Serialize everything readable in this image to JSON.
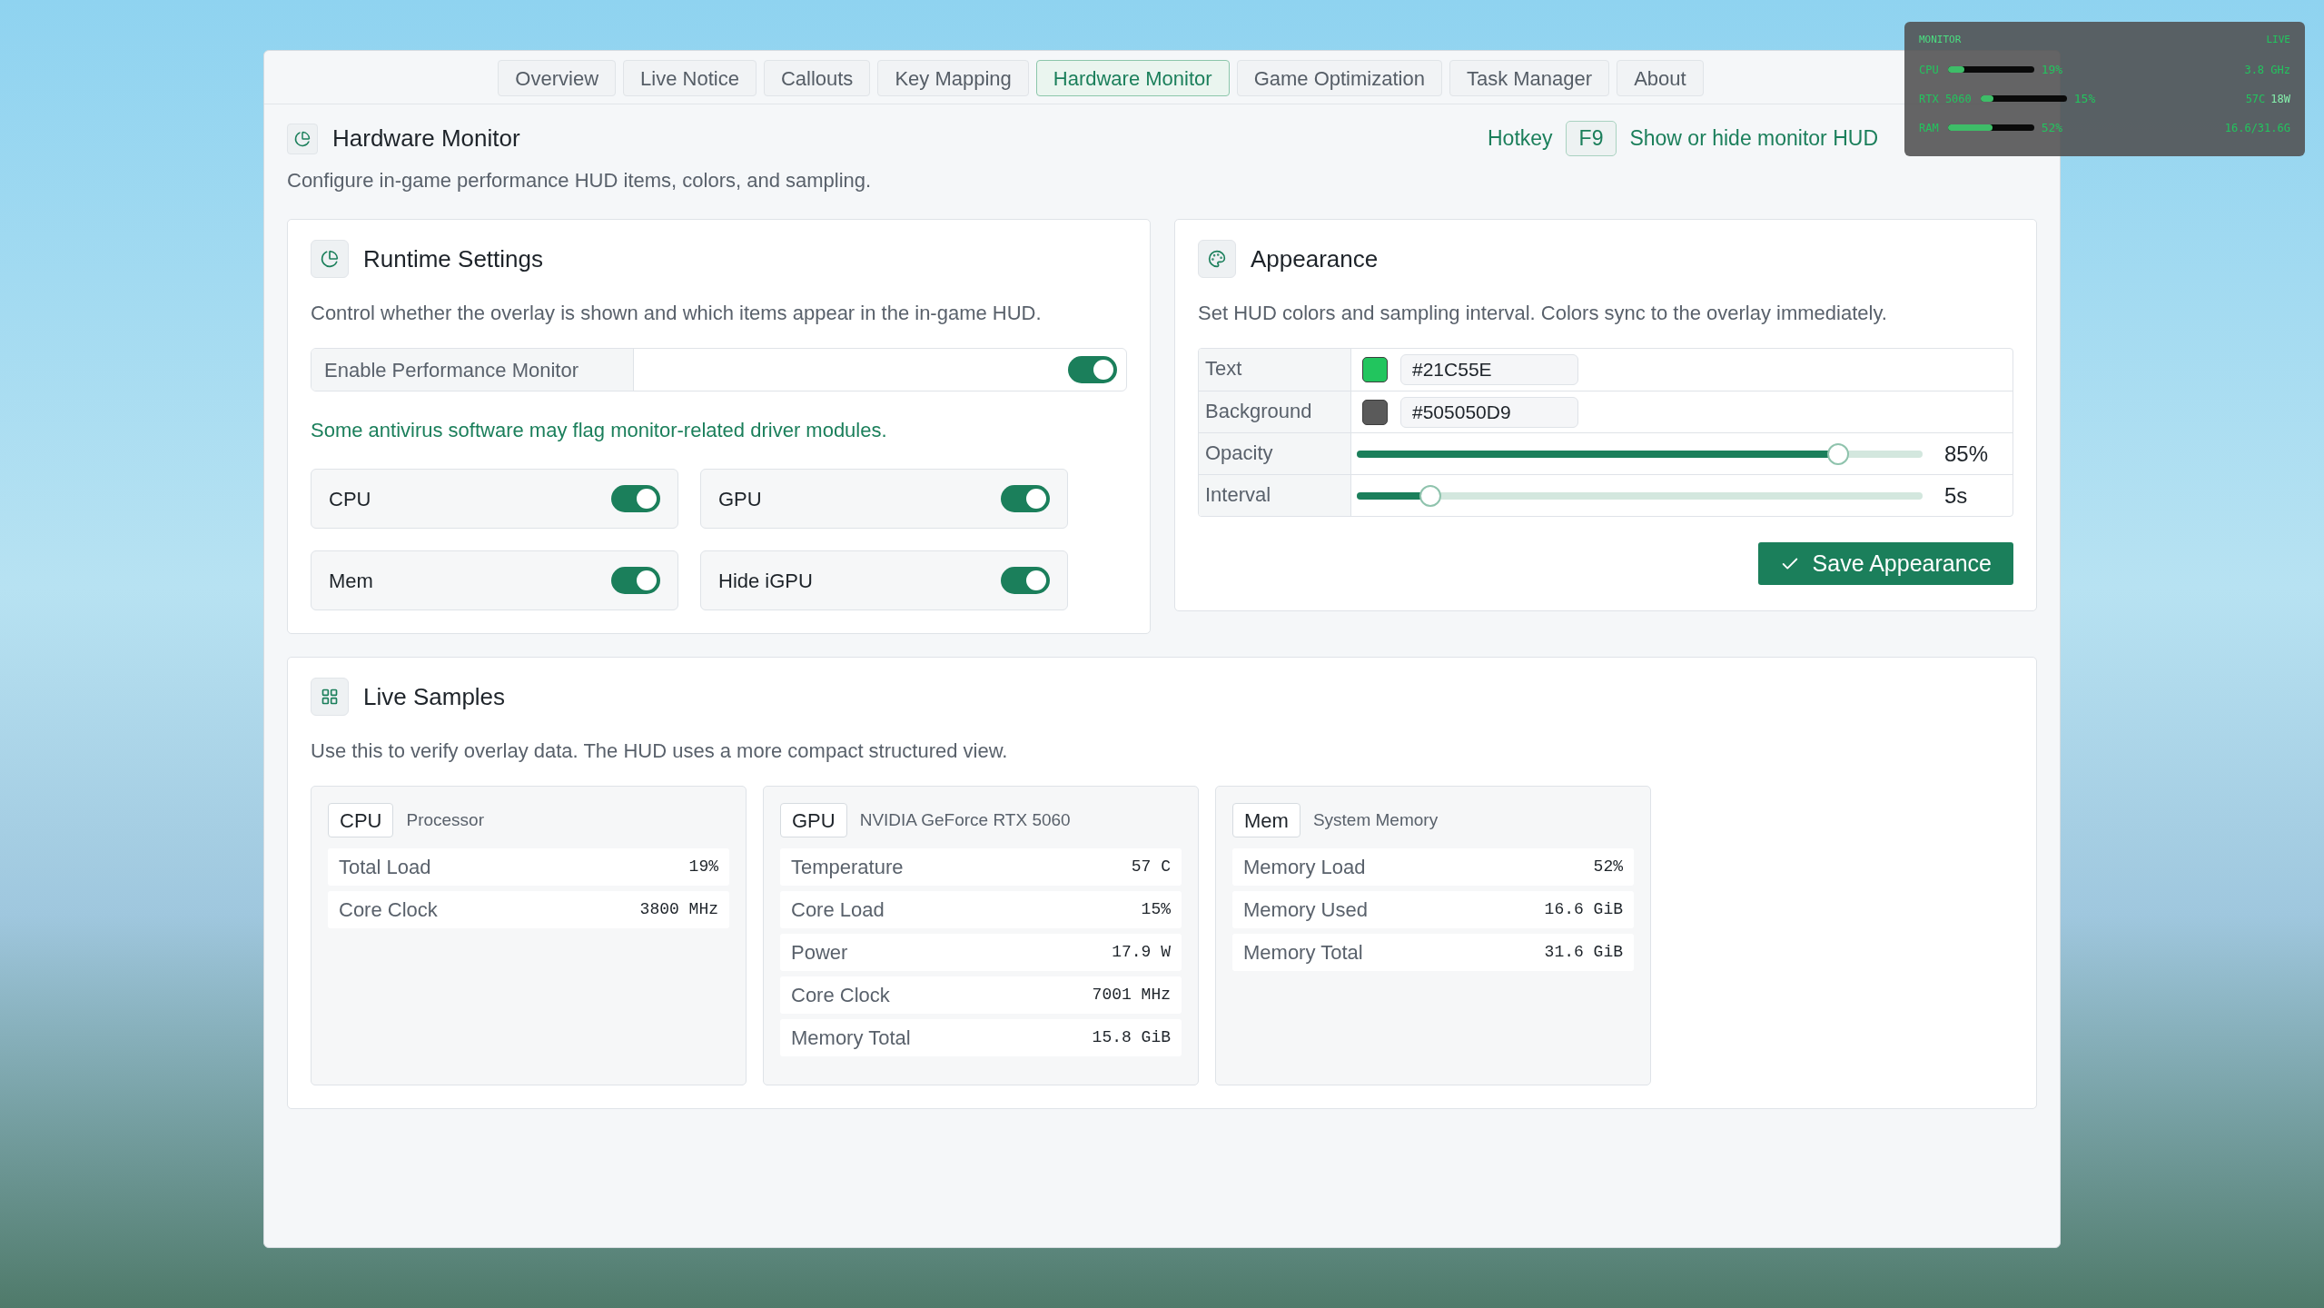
{
  "tabs": [
    {
      "label": "Overview",
      "selected": false
    },
    {
      "label": "Live Notice",
      "selected": false
    },
    {
      "label": "Callouts",
      "selected": false
    },
    {
      "label": "Key Mapping",
      "selected": false
    },
    {
      "label": "Hardware Monitor",
      "selected": true
    },
    {
      "label": "Game Optimization",
      "selected": false
    },
    {
      "label": "Task Manager",
      "selected": false
    },
    {
      "label": "About",
      "selected": false
    }
  ],
  "header": {
    "title": "Hardware Monitor",
    "description": "Configure in-game performance HUD items, colors, and sampling.",
    "hotkey_label": "Hotkey",
    "hotkey_key": "F9",
    "hotkey_hint": "Show or hide monitor HUD"
  },
  "runtime": {
    "title": "Runtime Settings",
    "description": "Control whether the overlay is shown and which items appear in the in-game HUD.",
    "enable": {
      "label": "Enable Performance Monitor",
      "on": true
    },
    "warning": "Some antivirus software may flag monitor-related driver modules.",
    "toggles": [
      {
        "label": "CPU",
        "on": true
      },
      {
        "label": "GPU",
        "on": true
      },
      {
        "label": "Mem",
        "on": true
      },
      {
        "label": "Hide iGPU",
        "on": true
      }
    ]
  },
  "appearance": {
    "title": "Appearance",
    "description": "Set HUD colors and sampling interval. Colors sync to the overlay immediately.",
    "rows": [
      {
        "kind": "color",
        "label": "Text",
        "color": "#22c55e",
        "value": "#21C55E"
      },
      {
        "kind": "color",
        "label": "Background",
        "color": "#5a5a5a",
        "value": "#505050D9"
      },
      {
        "kind": "slider",
        "label": "Opacity",
        "level": 0.85,
        "reading": "85%"
      },
      {
        "kind": "slider",
        "label": "Interval",
        "level": 0.13,
        "reading": "5s"
      }
    ],
    "save_button": "Save Appearance"
  },
  "samples": {
    "title": "Live Samples",
    "description": "Use this to verify overlay data. The HUD uses a more compact structured view.",
    "cards": [
      {
        "tag": "CPU",
        "name": "Processor",
        "rows": [
          {
            "label": "Total Load",
            "value": "19%"
          },
          {
            "label": "Core Clock",
            "value": "3800 MHz"
          }
        ]
      },
      {
        "tag": "GPU",
        "name": "NVIDIA GeForce RTX 5060",
        "rows": [
          {
            "label": "Temperature",
            "value": "57 C"
          },
          {
            "label": "Core Load",
            "value": "15%"
          },
          {
            "label": "Power",
            "value": "17.9 W"
          },
          {
            "label": "Core Clock",
            "value": "7001 MHz"
          },
          {
            "label": "Memory Total",
            "value": "15.8 GiB"
          }
        ]
      },
      {
        "tag": "Mem",
        "name": "System Memory",
        "rows": [
          {
            "label": "Memory Load",
            "value": "52%"
          },
          {
            "label": "Memory Used",
            "value": "16.6 GiB"
          },
          {
            "label": "Memory Total",
            "value": "31.6 GiB"
          }
        ]
      }
    ]
  },
  "hud": {
    "title": "MONITOR",
    "status": "LIVE",
    "rows": [
      {
        "label": "CPU",
        "level": 0.19,
        "reading": "19%",
        "info": [
          "3.8 GHz"
        ]
      },
      {
        "label": "RTX 5060",
        "level": 0.15,
        "reading": "15%",
        "info": [
          "57C",
          "18W"
        ]
      },
      {
        "label": "RAM",
        "level": 0.52,
        "reading": "52%",
        "info": [
          "16.6/31.6G"
        ]
      }
    ]
  }
}
